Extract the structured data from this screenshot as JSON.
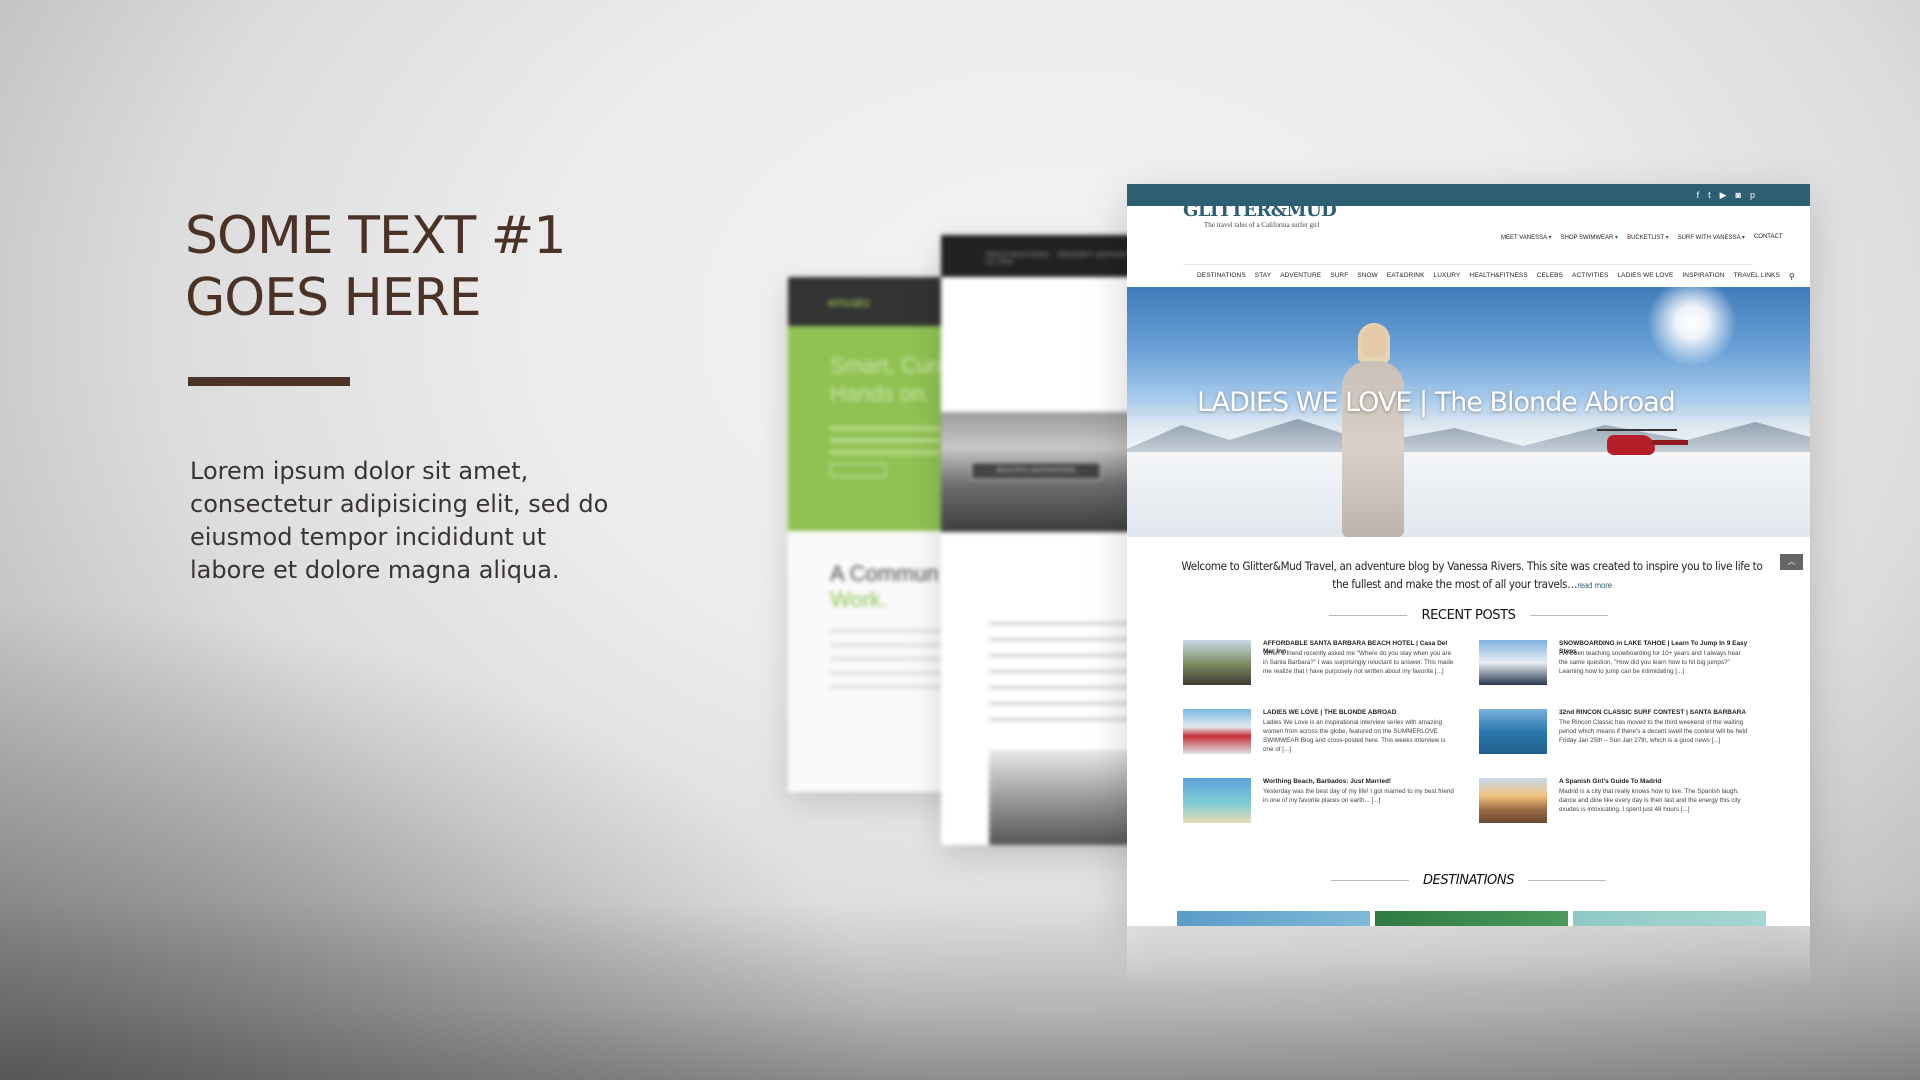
{
  "slide": {
    "title_line1": "SOME TEXT #1",
    "title_line2": "GOES HERE",
    "body": "Lorem ipsum dolor sit amet, consectetur adipisicing elit, sed do eiusmod tempor incididunt ut labore et dolore magna aliqua."
  },
  "background_pages": {
    "envato": {
      "logo": "envato",
      "hero_line1": "Smart, Cura",
      "hero_line2": "Hands on.",
      "sub_line1": "A Commun",
      "sub_line2": "Work."
    },
    "destinations": {
      "header": "DESTINATIONS · RESORT REPORT · ULTRA",
      "badge": "BEAUTIFUL DESTINATIONS"
    }
  },
  "site": {
    "logo": "GLITTER&MUD",
    "tagline": "The travel tales of a California surfer girl",
    "social_icons": [
      "facebook-icon",
      "twitter-icon",
      "youtube-icon",
      "instagram-icon",
      "pinterest-icon"
    ],
    "top_nav": [
      {
        "label": "MEET VANESSA",
        "dropdown": true
      },
      {
        "label": "SHOP SWIMWEAR",
        "dropdown": true
      },
      {
        "label": "BUCKETLIST",
        "dropdown": true
      },
      {
        "label": "SURF WITH VANESSA",
        "dropdown": true
      },
      {
        "label": "CONTACT",
        "dropdown": false
      }
    ],
    "main_nav": [
      "DESTINATIONS",
      "STAY",
      "ADVENTURE",
      "SURF",
      "SNOW",
      "EAT&DRINK",
      "LUXURY",
      "HEALTH&FITNESS",
      "CELEBS",
      "ACTIVITIES",
      "LADIES WE LOVE",
      "INSPIRATION",
      "TRAVEL LINKS"
    ],
    "hero_title": "LADIES WE LOVE | The Blonde Abroad",
    "intro_text": "Welcome to Glitter&Mud Travel, an adventure blog by Vanessa Rivers. This site was created to inspire you to live life to the fullest and make the most of all your travels…",
    "intro_more": "read more",
    "recent_posts_title": "RECENT POSTS",
    "posts": [
      {
        "title": "AFFORDABLE SANTA BARBARA BEACH HOTEL | Casa Del Mar Inn",
        "excerpt": "When a friend recently asked me \"Where do you stay when you are in Santa Barbara?\" I was surprisingly reluctant to answer. This made me realize that I have purposely not written about my favorite [...]"
      },
      {
        "title": "SNOWBOARDING in LAKE TAHOE | Learn To Jump In 9 Easy Steps",
        "excerpt": "I've been teaching snowboarding for 10+ years and I always hear the same question, \"How did you learn how to hit big jumps?\" Learning how to jump can be intimidating [...]"
      },
      {
        "title": "LADIES WE LOVE | THE BLONDE ABROAD",
        "excerpt": "Ladies We Love is an inspirational interview series with amazing women from across the globe, featured on the SUMMERLOVE SWIMWEAR Blog and cross-posted here. This weeks interview is one of [...]"
      },
      {
        "title": "32nd RINCON CLASSIC SURF CONTEST | SANTA BARBARA",
        "excerpt": "The Rincon Classic has moved to the third weekend of the waiting period which means if there's a decent swell the contest will be held Friday Jan 25th – Sun Jan 27th, which is a good news [...]"
      },
      {
        "title": "Worthing Beach, Barbados: Just Married!",
        "excerpt": "Yesterday was the best day of my life! I got married to my best friend in one of my favorite places on earth... [...]"
      },
      {
        "title": "A Spanish Girl's Guide To Madrid",
        "excerpt": "Madrid is a city that really knows how to live. The Spanish laugh, dance and dine like every day is their last and the energy this city exudes is intoxicating. I spent just 48 hours [...]"
      }
    ],
    "destinations_title": "DESTINATIONS",
    "scroll_top_icon": "chevron-up-icon"
  },
  "colors": {
    "title_brown": "#4a3226",
    "site_teal": "#2d5f73",
    "envato_green": "#8fc153"
  }
}
